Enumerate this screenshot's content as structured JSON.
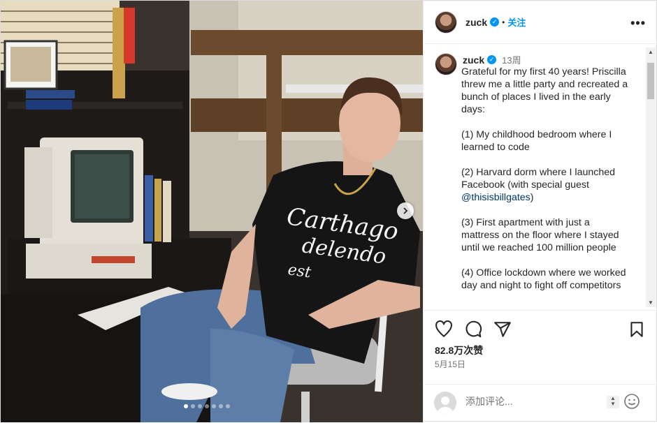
{
  "post": {
    "username": "zuck",
    "verified_mark": "✓",
    "separator": "•",
    "follow_label": "关注",
    "more_label": "•••",
    "time_ago": "13周",
    "caption": [
      "Grateful for my first 40 years! Priscilla threw me a little party and recreated a bunch of places I lived in the early days:",
      "(1) My childhood bedroom where I learned to code",
      "(2) Harvard dorm where I launched Facebook (with special guest ",
      "(3) First apartment with just a mattress on the floor where I stayed until we reached 100 million people",
      "(4) Office lockdown where we worked day and night to fight off competitors"
    ],
    "mention": "@thisisbillgates",
    "mention_suffix": ")",
    "likes": "82.8万次赞",
    "date": "5月15日",
    "comment_placeholder": "添加评论...",
    "carousel": {
      "slide_count": 7,
      "active_index": 0
    },
    "shirt_text": [
      "Carthago",
      "delendo",
      "est"
    ]
  },
  "icons": {
    "like": "heart-icon",
    "comment": "comment-icon",
    "share": "send-icon",
    "save": "bookmark-icon",
    "next": "chevron-right-icon",
    "emoji": "emoji-icon"
  },
  "colors": {
    "accent": "#0095f6",
    "text": "#262626",
    "muted": "#737373",
    "mention": "#00376b"
  }
}
